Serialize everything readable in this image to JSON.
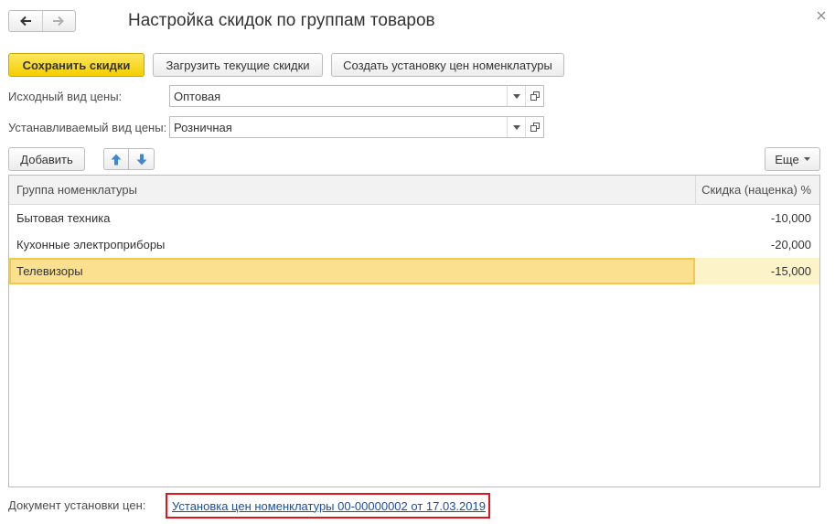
{
  "window": {
    "title": "Настройка скидок по группам товаров",
    "nav_back_icon": "arrow-left-icon",
    "nav_forward_icon": "arrow-right-icon",
    "close_icon": "close-icon"
  },
  "toolbar": {
    "save_label": "Сохранить скидки",
    "load_label": "Загрузить текущие скидки",
    "create_label": "Создать установку цен номенклатуры"
  },
  "form": {
    "source_price_label": "Исходный вид цены:",
    "source_price_value": "Оптовая",
    "target_price_label": "Устанавливаемый вид цены:",
    "target_price_value": "Розничная"
  },
  "table_toolbar": {
    "add_label": "Добавить",
    "more_label": "Еще"
  },
  "table": {
    "columns": [
      "Группа номенклатуры",
      "Скидка (наценка) %"
    ],
    "rows": [
      {
        "group": "Бытовая техника",
        "discount": "-10,000"
      },
      {
        "group": "Кухонные электроприборы",
        "discount": "-20,000"
      },
      {
        "group": "Телевизоры",
        "discount": "-15,000"
      }
    ],
    "selected_row_index": 2
  },
  "footer": {
    "doc_label": "Документ установки цен:",
    "doc_link": "Установка цен номенклатуры 00-00000002 от 17.03.2019"
  },
  "colors": {
    "primary_button": "#f5cf00",
    "selected_row": "#fbe18f",
    "link": "#1a4fa0",
    "highlight_box": "#e0141e"
  }
}
